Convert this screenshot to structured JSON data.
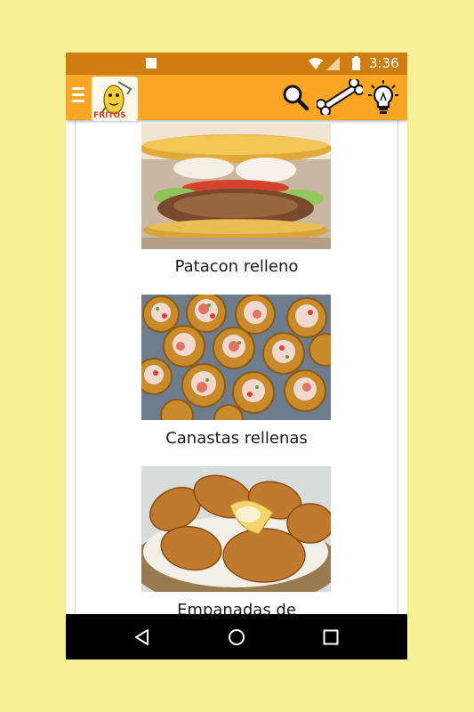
{
  "status_bar": {
    "time": "3:36"
  },
  "app_bar": {
    "menu_icon": "hamburger-menu-icon",
    "logo_text": "FRITOS",
    "actions": [
      "search-icon",
      "bone-icon",
      "lightbulb-icon"
    ]
  },
  "recipes": [
    {
      "name": "Patacon relleno",
      "image": "patacon-relleno-photo"
    },
    {
      "name": "Canastas rellenas",
      "image": "canastas-rellenas-photo"
    },
    {
      "name": "Empanadas de",
      "image": "empanadas-photo"
    }
  ],
  "nav_bar": {
    "buttons": [
      "back-icon",
      "home-icon",
      "recents-icon"
    ]
  },
  "colors": {
    "status_bar": "#ce7e10",
    "app_bar": "#fba525",
    "background": "#f8f097"
  }
}
